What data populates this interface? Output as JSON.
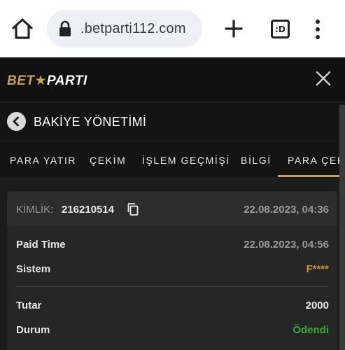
{
  "browser": {
    "url": ".betparti112.com",
    "tabs_count_label": ":D"
  },
  "site": {
    "logo_bet": "BET",
    "logo_star": "★",
    "logo_parti": "PARTI",
    "brand_color": "#c9a04d"
  },
  "page": {
    "title": "BAKİYE YÖNETİMİ"
  },
  "tabs": [
    {
      "label": "PARA YATIR"
    },
    {
      "label": "ÇEKİM"
    },
    {
      "label": "İŞLEM GEÇMİŞİ"
    },
    {
      "label": "BİLGİ"
    },
    {
      "label": "PARA ÇEKM",
      "active": true
    }
  ],
  "transaction": {
    "id_label": "KİMLİK:",
    "id_value": "216210514",
    "created": "22.08.2023, 04:36",
    "rows": [
      {
        "label": "Paid Time",
        "value": "22.08.2023, 04:56",
        "color": "#9a9a9a"
      },
      {
        "label": "Sistem",
        "value": "F****",
        "color": "#c9962f"
      },
      {
        "label": "Tutar",
        "value": "2000",
        "color": "#e8e8e8"
      },
      {
        "label": "Durum",
        "value": "Ödendi",
        "color": "#2fae3a"
      }
    ]
  }
}
